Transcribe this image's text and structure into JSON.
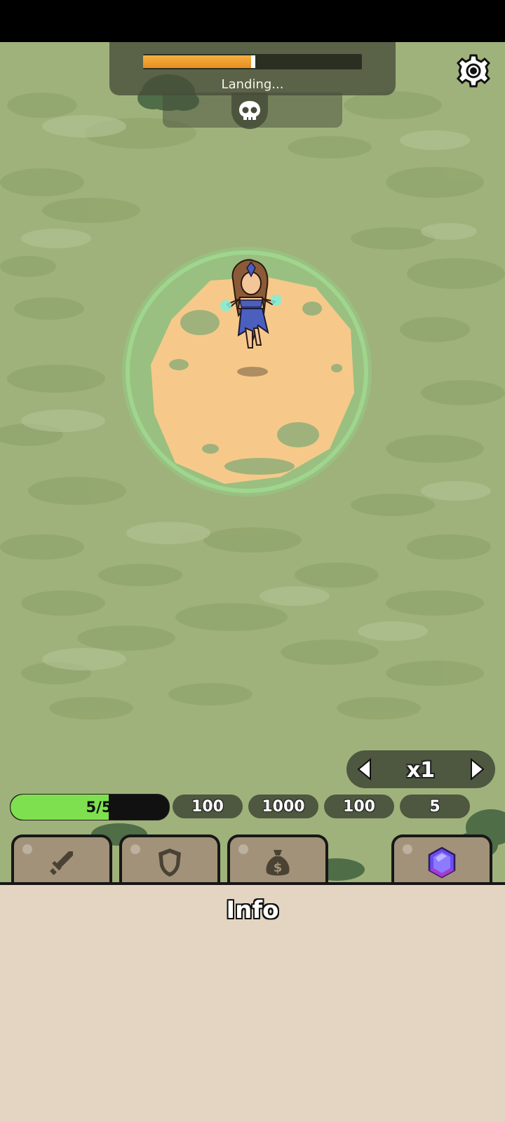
{
  "wave": {
    "status_text": "Landing...",
    "progress": 0.5
  },
  "hero": {
    "hp_current": 5,
    "hp_max": 5,
    "hp_text": "5/5"
  },
  "speed": {
    "value": "x1"
  },
  "stats": [
    "100",
    "1000",
    "100",
    "5"
  ],
  "tabs": [
    {
      "icon": "sword-icon"
    },
    {
      "icon": "shield-icon"
    },
    {
      "icon": "money-bag-icon"
    },
    {
      "icon": "gem-icon"
    }
  ],
  "info": {
    "title": "Info"
  },
  "colors": {
    "hp_fill": "#7ee04e",
    "progress_fill": "#f0a030",
    "panel_bg": "#e3d5c2",
    "grass": "#9fb27b",
    "sand": "#f6c98a",
    "gem": "#7b5cff"
  }
}
